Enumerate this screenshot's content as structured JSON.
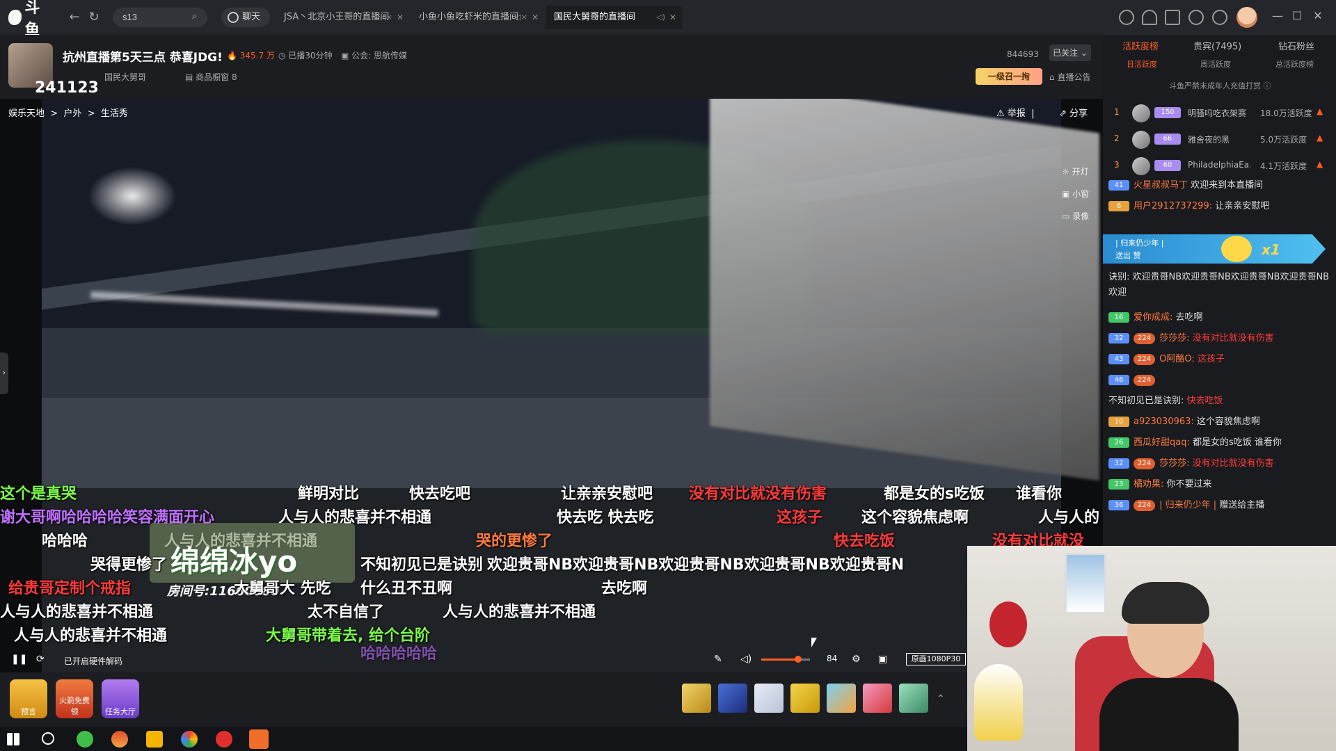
{
  "app": {
    "logo_text": "斗鱼",
    "search_value": "s13",
    "chat_label": "聊天",
    "tabs": [
      {
        "label": "JSA丶北京小王哥的直播间"
      },
      {
        "label": "小鱼小鱼吃虾米的直播间"
      },
      {
        "label": "国民大舅哥的直播间"
      }
    ]
  },
  "room": {
    "title": "抗州直播第5天三点 恭喜JDG!",
    "hot": "345.7 万",
    "duration": "已播30分钟",
    "guild": "公会: 思航传媒",
    "anchor_name": "国民大舅哥",
    "shop": "商品橱窗 8",
    "room_id_big": "241123",
    "room_id_small": "844693",
    "follow_label": "已关注",
    "promo_label": "一级召一拘",
    "notice_label": "直播公告"
  },
  "video": {
    "breadcrumb": [
      "娱乐天地",
      "户外",
      "生活秀"
    ],
    "report_label": "举报",
    "share_label": "分享",
    "side_tools": [
      "开灯",
      "小窗",
      "录像"
    ],
    "ad_text": "绵绵冰yo",
    "ad_room": "房间号:11660080",
    "hw_decode": "已开启硬件解码",
    "volume": "84",
    "volume_level": 0.75,
    "quality": "原画1080P30"
  },
  "danmaku": [
    {
      "text": "这个是真哭",
      "color": "#7cfc4a"
    },
    {
      "text": "鲜明对比",
      "color": "#ffffff"
    },
    {
      "text": "快去吃吧",
      "color": "#ffffff"
    },
    {
      "text": "让亲亲安慰吧",
      "color": "#ffffff"
    },
    {
      "text": "没有对比就没有伤害",
      "color": "#ff3b3b"
    },
    {
      "text": "都是女的s吃饭",
      "color": "#ffffff"
    },
    {
      "text": "谁看你",
      "color": "#ffffff"
    },
    {
      "text": "谢大哥啊哈哈哈哈笑容满面开心",
      "color": "#c070ff"
    },
    {
      "text": "人与人的悲喜并不相通",
      "color": "#ffffff"
    },
    {
      "text": "快去吃 快去吃",
      "color": "#ffffff"
    },
    {
      "text": "这孩子",
      "color": "#ff3b3b"
    },
    {
      "text": "这个容貌焦虑啊",
      "color": "#ffffff"
    },
    {
      "text": "人与人的",
      "color": "#ffffff"
    },
    {
      "text": "哈哈哈",
      "color": "#ffffff"
    },
    {
      "text": "人与人的悲喜并不相通",
      "color": "#ffffff"
    },
    {
      "text": "哭的更惨了",
      "color": "#ff7a3c"
    },
    {
      "text": "快去吃饭",
      "color": "#ff3b3b"
    },
    {
      "text": "没有对比就没",
      "color": "#ff3b3b"
    },
    {
      "text": "哭得更惨了",
      "color": "#ffffff"
    },
    {
      "text": "不知初见已是诀别",
      "color": "#ffffff"
    },
    {
      "text": "欢迎贵哥NB欢迎贵哥NB欢迎贵哥NB欢迎贵哥NB欢迎贵哥N",
      "color": "#ffffff"
    },
    {
      "text": "给贵哥定制个戒指",
      "color": "#ff3b3b"
    },
    {
      "text": "大舅哥大 先吃",
      "color": "#ffffff"
    },
    {
      "text": "什么丑不丑啊",
      "color": "#ffffff"
    },
    {
      "text": "去吃啊",
      "color": "#ffffff"
    },
    {
      "text": "人与人的悲喜并不相通",
      "color": "#ffffff"
    },
    {
      "text": "太不自信了",
      "color": "#ffffff"
    },
    {
      "text": "人与人的悲喜并不相通",
      "color": "#ffffff"
    },
    {
      "text": "人与人的悲喜并不相通",
      "color": "#ffffff"
    },
    {
      "text": "大舅哥带着去, 给个台阶",
      "color": "#7cfc4a"
    },
    {
      "text": "哈哈哈哈哈",
      "color": "#c070ff"
    }
  ],
  "giftbar": {
    "left_items": [
      "预言",
      "火箭免费领",
      "任务大厅"
    ]
  },
  "rpanel": {
    "tabs": [
      "活跃度榜",
      "贵宾(7495)",
      "钻石粉丝"
    ],
    "subtabs": [
      "日活跃度",
      "周活跃度",
      "总活跃度榜"
    ],
    "warning": "斗鱼严禁未成年人充值打赏",
    "ranks": [
      {
        "n": "1",
        "lv": "150",
        "name": "明骚吗吃衣架赛",
        "val": "18.0万活跃度"
      },
      {
        "n": "2",
        "lv": "66",
        "name": "雅舍夜的黑",
        "val": "5.0万活跃度"
      },
      {
        "n": "3",
        "lv": "60",
        "name": "PhiladelphiaEa...",
        "val": "4.1万活跃度"
      }
    ],
    "enter_banner": {
      "line1": "| 归来仍少年 |",
      "line2": "送出 赞",
      "count": "x1"
    },
    "messages": [
      {
        "badge": "41",
        "badge_class": "b-blue",
        "user": "火星叔叔马丁",
        "text": "欢迎来到本直播间",
        "text_color": "#ddd"
      },
      {
        "badge": "6",
        "badge_class": "b-gold",
        "user": "用户2912737299:",
        "text": "让亲亲安慰吧",
        "text_color": "#ddd"
      },
      {
        "badge": "",
        "badge_class": "",
        "user": "诀别:",
        "text": "欢迎贵哥NB欢迎贵哥NB欢迎贵哥NB欢迎贵哥NB欢迎",
        "text_color": "#ddd"
      },
      {
        "badge": "16",
        "badge_class": "b-green",
        "user": "爱你成成:",
        "text": "去吃啊",
        "text_color": "#ddd"
      },
      {
        "badge": "32",
        "badge_class": "b-blue",
        "medal": "224",
        "user": "莎莎莎:",
        "text": "没有对比就没有伤害",
        "text_color": "#ff3b3b"
      },
      {
        "badge": "43",
        "badge_class": "b-blue",
        "medal": "224",
        "user": "O阿酪O:",
        "text": "这孩子",
        "text_color": "#ff3b3b"
      },
      {
        "badge": "46",
        "badge_class": "b-blue",
        "medal": "224",
        "user": "",
        "text": "",
        "text_color": "#ddd"
      },
      {
        "badge": "",
        "badge_class": "",
        "user": "不知初见已是诀别:",
        "text": "快去吃饭",
        "text_color": "#ff3b3b"
      },
      {
        "badge": "10",
        "badge_class": "b-gold",
        "user": "a923030963:",
        "text": "这个容貌焦虑啊",
        "text_color": "#ddd"
      },
      {
        "badge": "26",
        "badge_class": "b-green",
        "user": "西瓜好甜qaq:",
        "text": "都是女的s吃饭 谁看你",
        "text_color": "#ddd"
      },
      {
        "badge": "32",
        "badge_class": "b-blue",
        "medal": "224",
        "user": "莎莎莎:",
        "text": "没有对比就没有伤害",
        "text_color": "#ff3b3b"
      },
      {
        "badge": "23",
        "badge_class": "b-green",
        "user": "橘劝果:",
        "text": "你不要过来",
        "text_color": "#ddd"
      },
      {
        "badge": "36",
        "badge_class": "b-blue",
        "medal": "224",
        "user": "| 归来仍少年 |",
        "text": "赠送给主播",
        "text_color": "#ddd"
      }
    ]
  }
}
